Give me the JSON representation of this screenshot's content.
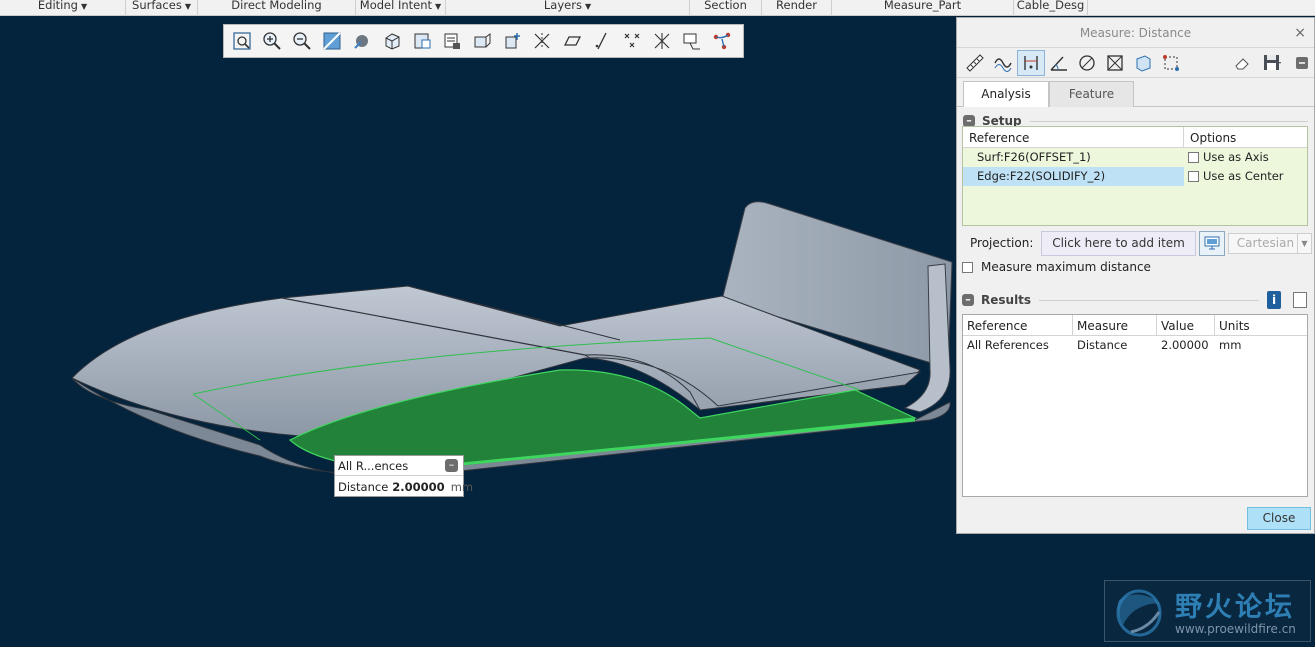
{
  "ribbon": {
    "groups": [
      {
        "label": "Editing",
        "caret": "▼"
      },
      {
        "label": "Surfaces",
        "caret": "▼"
      },
      {
        "label": "Direct Modeling",
        "caret": ""
      },
      {
        "label": "Model Intent",
        "caret": "▼"
      },
      {
        "label": "Layers",
        "caret": "▼"
      },
      {
        "label": "Section",
        "caret": ""
      },
      {
        "label": "Render",
        "caret": ""
      },
      {
        "label": "Measure_Part",
        "caret": ""
      },
      {
        "label": "Cable_Desg",
        "caret": ""
      }
    ]
  },
  "view_toolbar": {
    "icons": [
      "refit-icon",
      "zoom-in-icon",
      "zoom-out-icon",
      "repaint-icon",
      "display-style-icon",
      "saved-orientations-icon",
      "named-views-icon",
      "view-manager-icon",
      "perspective-icon",
      "spin-center-icon",
      "datum-display-icon",
      "plane-display-icon",
      "axis-display-icon",
      "point-display-icon",
      "csys-display-icon",
      "annotation-display-icon",
      "sketch-tool-icon"
    ]
  },
  "callout": {
    "reference": "All R...ences",
    "measure": "Distance",
    "value": "2.00000",
    "unit": "mm",
    "collapse": "–"
  },
  "dialog": {
    "title": "Measure: Distance",
    "close": "×",
    "tabs": [
      "Analysis",
      "Feature"
    ],
    "setup": {
      "title": "Setup",
      "columns": [
        "Reference",
        "Options"
      ],
      "rows": [
        {
          "reference": "Surf:F26(OFFSET_1)",
          "option": "Use as Axis"
        },
        {
          "reference": "Edge:F22(SOLIDIFY_2)",
          "option": "Use as Center"
        }
      ]
    },
    "projection": {
      "label": "Projection:",
      "placeholder": "Click here to add item",
      "mode": "Cartesian"
    },
    "measure_max": "Measure maximum distance",
    "results": {
      "title": "Results",
      "columns": [
        "Reference",
        "Measure",
        "Value",
        "Units"
      ],
      "rows": [
        {
          "reference": "All References",
          "measure": "Distance",
          "value": "2.00000",
          "units": "mm"
        }
      ]
    },
    "close_label": "Close"
  },
  "watermark": {
    "text_cn": "野火论坛",
    "url": "www.proewildfire.cn"
  },
  "colors": {
    "background": "#04233d",
    "model_surface": "#a3aebb",
    "highlight": "#22823a",
    "selected_row": "#bfe1f5"
  }
}
